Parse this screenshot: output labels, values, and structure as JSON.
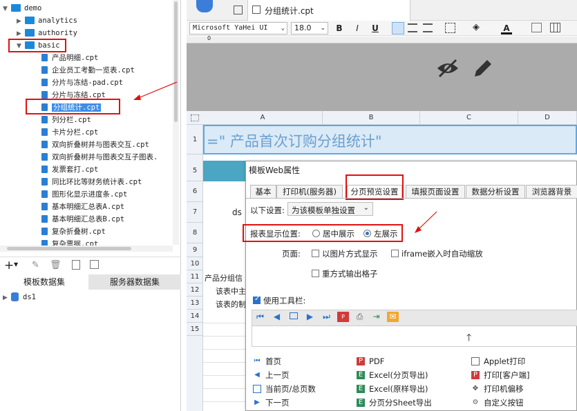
{
  "tree": {
    "items": [
      {
        "label": "demo",
        "type": "folder",
        "level": 0,
        "expanded": true
      },
      {
        "label": "analytics",
        "type": "folder",
        "level": 1,
        "expanded": false
      },
      {
        "label": "authority",
        "type": "folder",
        "level": 1,
        "expanded": false
      },
      {
        "label": "basic",
        "type": "folder",
        "level": 1,
        "expanded": true
      },
      {
        "label": "产品明细.cpt",
        "type": "file",
        "level": 2
      },
      {
        "label": "企业员工考勤一览表.cpt",
        "type": "file",
        "level": 2
      },
      {
        "label": "分片与冻结-pad.cpt",
        "type": "file",
        "level": 2
      },
      {
        "label": "分片与冻结.cpt",
        "type": "file",
        "level": 2
      },
      {
        "label": "分组统计.cpt",
        "type": "file",
        "level": 2,
        "selected": true
      },
      {
        "label": "列分栏.cpt",
        "type": "file",
        "level": 2
      },
      {
        "label": "卡片分栏.cpt",
        "type": "file",
        "level": 2
      },
      {
        "label": "双向折叠树并与图表交互.cpt",
        "type": "file",
        "level": 2
      },
      {
        "label": "双向折叠树并与图表交互子图表.",
        "type": "file",
        "level": 2
      },
      {
        "label": "发票套打.cpt",
        "type": "file",
        "level": 2
      },
      {
        "label": "同比环比等财务统计表.cpt",
        "type": "file",
        "level": 2
      },
      {
        "label": "图形化显示进度条.cpt",
        "type": "file",
        "level": 2
      },
      {
        "label": "基本明细汇总表A.cpt",
        "type": "file",
        "level": 2
      },
      {
        "label": "基本明细汇总表B.cpt",
        "type": "file",
        "level": 2
      },
      {
        "label": "复杂折叠树.cpt",
        "type": "file",
        "level": 2
      },
      {
        "label": "复杂票据.cpt",
        "type": "file",
        "level": 2
      }
    ]
  },
  "dataset_panel": {
    "tabs": [
      "模板数据集",
      "服务器数据集"
    ],
    "items": [
      "ds1"
    ]
  },
  "editor_tab": {
    "title": "分组统计.cpt"
  },
  "format_bar": {
    "font": "Microsoft YaHei UI",
    "size": "18.0",
    "bold": "B",
    "italic": "I",
    "underline": "U",
    "font_color": "A"
  },
  "columns": [
    "A",
    "B",
    "C",
    "D"
  ],
  "rows": [
    "1",
    "5",
    "6",
    "7",
    "8",
    "9",
    "10",
    "11",
    "12",
    "13",
    "14",
    "15"
  ],
  "cells": {
    "title_formula": "=\" 产品首次订购分组统计\"",
    "c7": "ds",
    "c11": "产品分组信",
    "c12": "该表中主",
    "c13": "该表的制"
  },
  "dialog": {
    "title": "模板Web属性",
    "tabs": [
      "基本",
      "打印机(服务器)",
      "分页预览设置",
      "填报页面设置",
      "数据分析设置",
      "浏览器背景"
    ],
    "active_tab": "分页预览设置",
    "settings_label": "以下设置:",
    "settings_value": "为该模板单独设置",
    "position_label": "报表显示位置:",
    "position_options": [
      "居中展示",
      "左展示"
    ],
    "position_selected": "左展示",
    "page_label": "页面:",
    "page_opt1": "以图片方式显示",
    "page_opt2": "iframe嵌入时自动缩放",
    "page_opt3": "重方式输出格子",
    "toolbar_label": "使用工具栏:",
    "buttons_col1": [
      "首页",
      "上一页",
      "当前页/总页数",
      "下一页"
    ],
    "buttons_col2": [
      "PDF",
      "Excel(分页导出)",
      "Excel(原样导出)",
      "分页分Sheet导出"
    ],
    "buttons_col3": [
      "Applet打印",
      "打印[客户端]",
      "打印机偏移",
      "自定义按钮"
    ]
  },
  "colors": {
    "accent": "#3d8ee8",
    "highlight": "#e01010",
    "title_cell_bg": "#dbeaf7",
    "header_bg": "#4aa6c3"
  }
}
